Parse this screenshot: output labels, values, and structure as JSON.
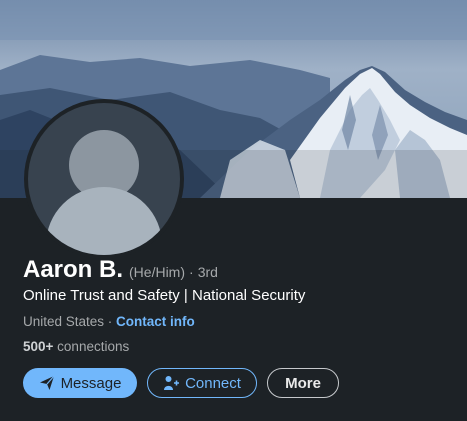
{
  "profile": {
    "name": "Aaron B.",
    "pronouns": "(He/Him)",
    "separator": "·",
    "degree": "3rd",
    "headline": "Online Trust and Safety | National Security",
    "location": "United States",
    "location_separator": " · ",
    "contact_info": "Contact info",
    "connections_count": "500+",
    "connections_label": " connections"
  },
  "actions": {
    "message": "Message",
    "connect": "Connect",
    "more": "More"
  },
  "icons": {
    "message": "send-icon",
    "connect": "add-person-icon"
  },
  "colors": {
    "accent": "#71b7fb",
    "background": "#1d2226"
  }
}
